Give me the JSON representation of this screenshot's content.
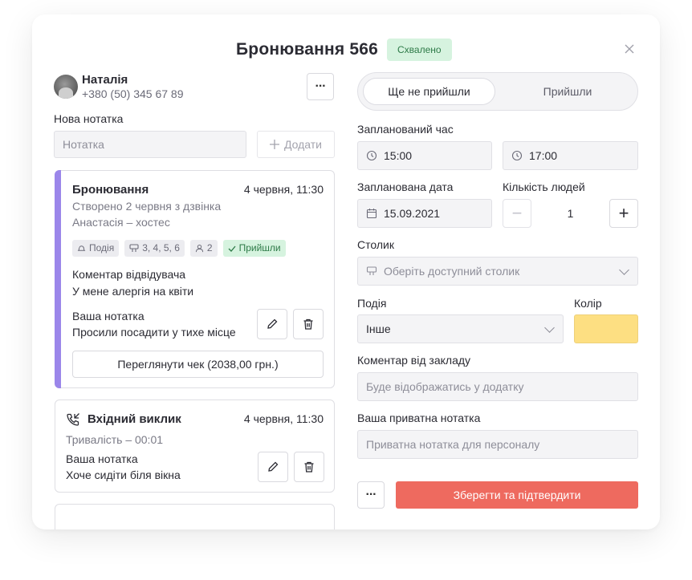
{
  "header": {
    "title": "Бронювання 566",
    "status_badge": "Схвалено",
    "close_icon": "close-icon"
  },
  "guest": {
    "name": "Наталія",
    "phone": "+380 (50) 345 67 89",
    "more_label": "···"
  },
  "new_note": {
    "label": "Нова нотатка",
    "placeholder": "Нотатка",
    "add_label": "Додати"
  },
  "booking_card": {
    "title": "Бронювання",
    "date": "4 червня, 11:30",
    "created": "Створено 2 червня з дзвінка",
    "host": "Анастасія – хостес",
    "chips": {
      "event": "Подія",
      "tables": "3, 4, 5, 6",
      "people": "2",
      "status": "Прийшли"
    },
    "visitor_comment_label": "Коментар відвідувача",
    "visitor_comment": "У мене алергія на квіти",
    "note_label": "Ваша нотатка",
    "note": "Просили посадити у тихе місце",
    "receipt_button": "Переглянути чек (2038,00 грн.)",
    "accent_color": "#9b86ea"
  },
  "call_card": {
    "title": "Вхідний виклик",
    "date": "4 червня, 11:30",
    "duration": "Тривалість – 00:01",
    "note_label": "Ваша нотатка",
    "note": "Хоче сидіти біля вікна"
  },
  "arrival_toggle": {
    "options": [
      "Ще не прийшли",
      "Прийшли"
    ],
    "selected": "Ще не прийшли"
  },
  "planned_time": {
    "label": "Запланований час",
    "start": "15:00",
    "end": "17:00"
  },
  "planned_date": {
    "label": "Запланована дата",
    "value": "15.09.2021"
  },
  "people": {
    "label": "Кількість людей",
    "value": "1",
    "minus": "−",
    "plus": "+"
  },
  "table": {
    "label": "Столик",
    "placeholder": "Оберіть доступний столик"
  },
  "event": {
    "label": "Подія",
    "value": "Інше"
  },
  "color": {
    "label": "Колір",
    "value": "#fddf82"
  },
  "venue_comment": {
    "label": "Коментар від закладу",
    "placeholder": "Буде відображатись у додатку"
  },
  "private_note": {
    "label": "Ваша приватна нотатка",
    "placeholder": "Приватна нотатка для персоналу"
  },
  "footer": {
    "more_label": "···",
    "save_label": "Зберегти та підтвердити",
    "save_color": "#ee6a5f"
  }
}
